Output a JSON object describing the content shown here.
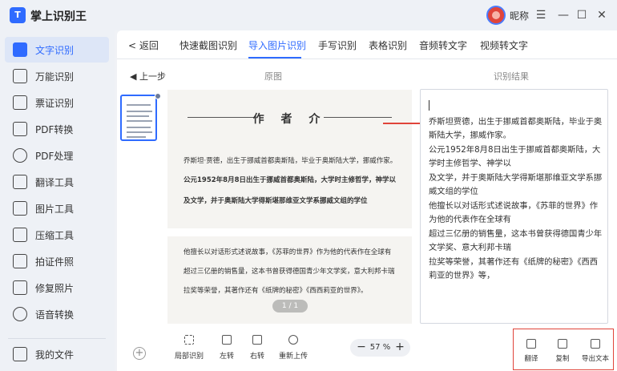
{
  "app": {
    "logo_letter": "T",
    "name": "掌上识别王",
    "user_name": "昵称"
  },
  "window": {
    "menu": "☰",
    "minimize": "—",
    "maximize": "☐",
    "close": "✕"
  },
  "sidebar": {
    "items": [
      {
        "label": "文字识别",
        "active": true
      },
      {
        "label": "万能识别"
      },
      {
        "label": "票证识别"
      },
      {
        "label": "PDF转换"
      },
      {
        "label": "PDF处理"
      },
      {
        "label": "翻译工具"
      },
      {
        "label": "图片工具"
      },
      {
        "label": "压缩工具"
      },
      {
        "label": "拍证件照"
      },
      {
        "label": "修复照片"
      },
      {
        "label": "语音转换"
      }
    ],
    "my_files": "我的文件"
  },
  "tabs": {
    "back": "< 返回",
    "items": [
      "快速截图识别",
      "导入图片识别",
      "手写识别",
      "表格识别",
      "音频转文字",
      "视频转文字"
    ],
    "active_index": 1
  },
  "subbar": {
    "prev": "◀ 上一步",
    "source_label": "原图",
    "result_label": "识别结果"
  },
  "source_image": {
    "title": "作 者 介",
    "lines": [
      "乔斯坦·贾德，出生于挪威首都奥斯陆，毕业于奥斯陆大学，挪威作家。",
      "公元1952年8月8日出生于挪威首都奥斯陆，大学时主修哲学，神学以",
      "及文学，并于奥斯陆大学得斯堪那维亚文学系挪威文组的学位",
      "他擅长以对话形式述说故事，《苏菲的世界》作为他的代表作在全球有",
      "超过三亿册的销售量，这本书曾获得德国青少年文学奖，意大利邦卡瑞",
      "拉奖等荣誉，其著作还有《纸牌的秘密》《西西莉亚的世界》。"
    ],
    "page_indicator": "1 / 1"
  },
  "result": {
    "lines": [
      "乔斯坦贾德，出生于挪威首都奥斯陆，毕业于奥",
      "斯陆大学，挪威作家。",
      "公元1952年8月8日出生于挪威首都奥斯陆，大",
      "学时主修哲学、神学以",
      "及文学，并于奥斯陆大学得斯堪那维亚文学系挪",
      "威文组的学位",
      "他擅长以对话形式述说故事，《苏菲的世界》作",
      "为他的代表作在全球有",
      "超过三亿册的销售量，这本书曾获得德国青少年",
      "文学奖、意大利邦卡瑞",
      "拉奖等荣誉，其著作还有《纸牌的秘密》《西西",
      "莉亚的世界》等，"
    ]
  },
  "toolbar": {
    "tools": [
      "局部识别",
      "左转",
      "右转",
      "重新上传"
    ],
    "zoom_minus": "−",
    "zoom_value": "57 %",
    "zoom_plus": "+",
    "add_symbol": "+",
    "export_tools": [
      "翻译",
      "复制",
      "导出文本"
    ]
  },
  "colors": {
    "accent": "#2f6bff",
    "highlight": "#e0443a"
  }
}
